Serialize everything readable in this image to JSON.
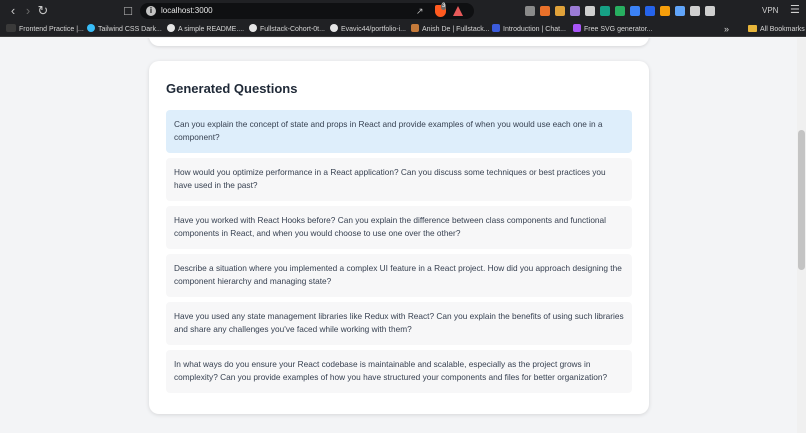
{
  "browser": {
    "url": "localhost:3000",
    "brave_badge": "3",
    "vpn_label": "VPN",
    "nav_icons": [
      "back-icon",
      "forward-icon",
      "reload-icon",
      "bookmark-icon"
    ],
    "extension_colors": [
      "#8a8a8a",
      "#e8702a",
      "#e0a23a",
      "#9b7bd6",
      "#cfcfcf",
      "#16a085",
      "#27ae60",
      "#3b82f6",
      "#2563eb",
      "#f59e0b",
      "#60a5fa",
      "#cfcfcf",
      "#cfcfcf"
    ]
  },
  "bookmarks": {
    "items": [
      {
        "label": "Frontend Practice |...",
        "color": "#3a3a3a"
      },
      {
        "label": "Tailwind CSS Dark...",
        "color": "#38bdf8"
      },
      {
        "label": "A simple README....",
        "color": "#e5e5e5"
      },
      {
        "label": "Fullstack-Cohort-0t...",
        "color": "#e5e5e5"
      },
      {
        "label": "Evavic44/portfolio-i...",
        "color": "#e5e5e5"
      },
      {
        "label": "Anish De | Fullstack...",
        "color": "#c47a3a"
      },
      {
        "label": "Introduction | Chat...",
        "color": "#3b5bdb"
      },
      {
        "label": "Free SVG generator...",
        "color": "#a855f7"
      }
    ],
    "more": "»",
    "all_bookmarks": "All Bookmarks"
  },
  "main": {
    "title": "Generated Questions",
    "questions": [
      "Can you explain the concept of state and props in React and provide examples of when you would use each one in a component?",
      "How would you optimize performance in a React application? Can you discuss some techniques or best practices you have used in the past?",
      "Have you worked with React Hooks before? Can you explain the difference between class components and functional components in React, and when you would choose to use one over the other?",
      "Describe a situation where you implemented a complex UI feature in a React project. How did you approach designing the component hierarchy and managing state?",
      "Have you used any state management libraries like Redux with React? Can you explain the benefits of using such libraries and share any challenges you've faced while working with them?",
      "In what ways do you ensure your React codebase is maintainable and scalable, especially as the project grows in complexity? Can you provide examples of how you have structured your components and files for better organization?"
    ]
  }
}
